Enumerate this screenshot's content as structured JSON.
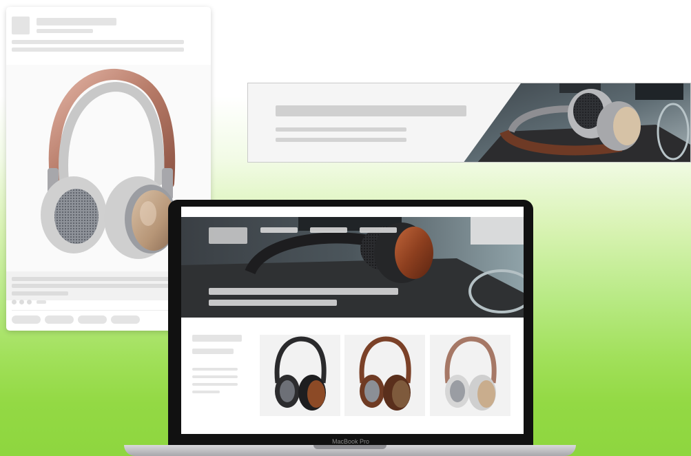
{
  "laptop": {
    "brand_label": "MacBook Pro"
  },
  "colors": {
    "background_top": "#ffffff",
    "background_bottom": "#8ed63f",
    "placeholder": "#e4e4e4",
    "leather_brown": "#7a3f22",
    "rose_gold": "#c28a78"
  },
  "icons": [
    "headphones-rosegold-image",
    "headphones-black-image",
    "headphones-brown-image",
    "headphones-white-image"
  ]
}
